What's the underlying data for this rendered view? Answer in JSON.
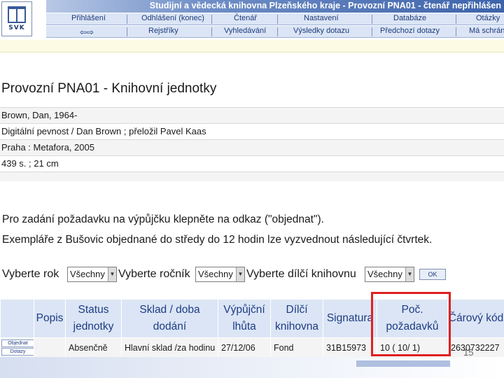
{
  "banner": {
    "logo_text": "SVK",
    "title": "Studijní a vědecká knihovna Plzeňského kraje - Provozní PNA01 - čtenář nepřihlášen",
    "nav_row1": [
      "Přihlášení",
      "Odhlášení (konec)",
      "Čtenář",
      "Nastavení",
      "Databáze",
      "Otázky"
    ],
    "nav_row2": [
      "Rejstříky",
      "Vyhledávání",
      "Výsledky dotazu",
      "Předchozí dotazy",
      "Má schránka"
    ],
    "arrow_icons": "⇦⇨"
  },
  "page_title": "Provozní PNA01 - Knihovní jednotky",
  "record": {
    "author": "Brown, Dan, 1964-",
    "title_line": "Digitální pevnost / Dan Brown ; přeložil Pavel Kaas",
    "publisher": "Praha : Metafora, 2005",
    "extent": " 439 s. ; 21 cm"
  },
  "info": {
    "line1": "Pro zadání požadavku na výpůjčku klepněte na odkaz (\"objednat\").",
    "line2": "Exempláře z Bušovic objednané do středy do 12 hodin lze vyzvednout následující čtvrtek."
  },
  "filters": {
    "year_label": "Vyberte rok",
    "year_value": "Všechny",
    "volume_label": "Vyberte ročník",
    "volume_value": "Všechny",
    "branch_label": "Vyberte dílčí knihovnu",
    "branch_value": "Všechny",
    "ok_label": "OK"
  },
  "table": {
    "headers": [
      "",
      "Popis",
      "Status jednotky",
      "Sklad / doba dodání",
      "Výpůjční lhůta",
      "Dílčí knihovna",
      "Signatura",
      "Poč. požadavků",
      "Čárový kód"
    ],
    "row": {
      "order_button": "Objednat",
      "queries_button": "Dotazy",
      "popis": "",
      "status": "Absenčně",
      "sklad": "Hlavní sklad /za hodinu",
      "lhuta": "27/12/06",
      "knihovna": "Fond",
      "signatura": "31B15973",
      "pozadavky": "10 ( 10/ 1)",
      "kod": "2630732227"
    }
  },
  "slide_number": "15",
  "colors": {
    "header_bg": "#dbe5f5",
    "header_text": "#1e3c82",
    "highlight": "#e02020"
  }
}
